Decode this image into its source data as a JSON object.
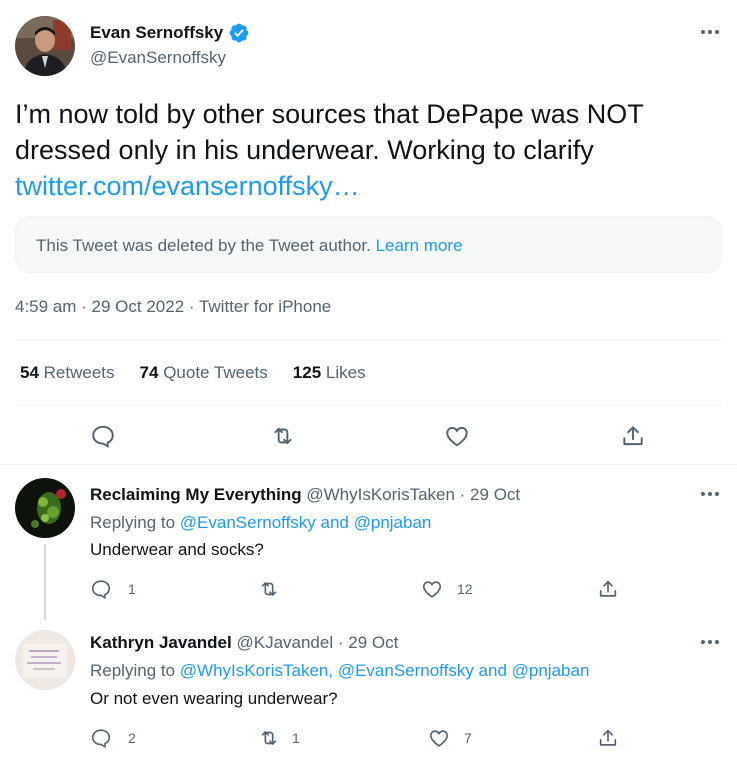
{
  "main_tweet": {
    "author_name": "Evan Sernoffsky",
    "author_handle": "@EvanSernoffsky",
    "text_part1": "I’m now told by other sources that DePape was NOT dressed only in his underwear. Working to clarify ",
    "text_link": "twitter.com/evansernoffsky…",
    "deleted_notice": "This Tweet was deleted by the Tweet author.",
    "learn_more": "Learn more",
    "timestamp": "4:59 am · 29 Oct 2022 · Twitter for iPhone",
    "stats": {
      "retweets_count": "54",
      "retweets_label": "Retweets",
      "quotes_count": "74",
      "quotes_label": "Quote Tweets",
      "likes_count": "125",
      "likes_label": "Likes"
    }
  },
  "replies": [
    {
      "name": "Reclaiming My Everything",
      "handle": "@WhyIsKorisTaken",
      "date": "· 29 Oct",
      "replying_label": "Replying to ",
      "replying_to_1": "@EvanSernoffsky",
      "joiner_1": " and ",
      "replying_to_2": "@pnjaban",
      "text": "Underwear and socks?",
      "reply_count": "1",
      "retweet_count": "",
      "like_count": "12"
    },
    {
      "name": "Kathryn Javandel",
      "handle": "@KJavandel",
      "date": "· 29 Oct",
      "replying_label": "Replying to ",
      "replying_to_1": "@WhyIsKorisTaken",
      "joiner_1": ", ",
      "replying_to_2": "@EvanSernoffsky",
      "joiner_2": " and ",
      "replying_to_3": "@pnjaban",
      "text": "Or not even wearing underwear?",
      "reply_count": "2",
      "retweet_count": "1",
      "like_count": "7"
    }
  ],
  "icons": {
    "verified": "verified-badge-icon",
    "more": "more-icon",
    "reply": "reply-icon",
    "retweet": "retweet-icon",
    "like": "heart-icon",
    "share": "share-icon"
  },
  "colors": {
    "accent": "#1d9bf0",
    "text": "#0f1419",
    "muted": "#536471",
    "border": "#eff3f4"
  }
}
